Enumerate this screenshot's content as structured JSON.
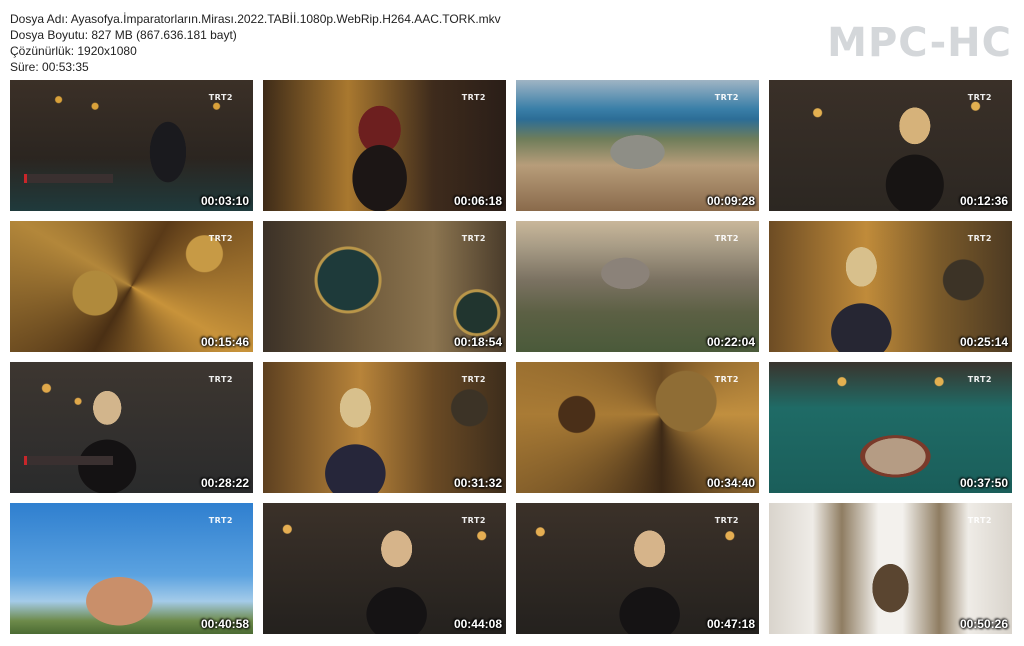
{
  "file_info": {
    "name_line": "Dosya Adı: Ayasofya.İmparatorların.Mirası.2022.TABİİ.1080p.WebRip.H264.AAC.TORK.mkv",
    "size_line": "Dosya Boyutu: 827 MB (867.636.181 bayt)",
    "resolution_line": "Çözünürlük: 1920x1080",
    "duration_line": "Süre: 00:53:35"
  },
  "logo": {
    "text": "MPC-HC",
    "color": "#d4d7da"
  },
  "thumbnails": [
    {
      "timestamp": "00:03:10",
      "channel_logo": "TRT2",
      "lower_third": true
    },
    {
      "timestamp": "00:06:18",
      "channel_logo": "TRT2"
    },
    {
      "timestamp": "00:09:28",
      "channel_logo": "TRT2"
    },
    {
      "timestamp": "00:12:36",
      "channel_logo": "TRT2"
    },
    {
      "timestamp": "00:15:46",
      "channel_logo": "TRT2"
    },
    {
      "timestamp": "00:18:54",
      "channel_logo": "TRT2"
    },
    {
      "timestamp": "00:22:04",
      "channel_logo": "TRT2"
    },
    {
      "timestamp": "00:25:14",
      "channel_logo": "TRT2"
    },
    {
      "timestamp": "00:28:22",
      "channel_logo": "TRT2",
      "lower_third": true
    },
    {
      "timestamp": "00:31:32",
      "channel_logo": "TRT2"
    },
    {
      "timestamp": "00:34:40",
      "channel_logo": "TRT2"
    },
    {
      "timestamp": "00:37:50",
      "channel_logo": "TRT2"
    },
    {
      "timestamp": "00:40:58",
      "channel_logo": "TRT2"
    },
    {
      "timestamp": "00:44:08",
      "channel_logo": "TRT2"
    },
    {
      "timestamp": "00:47:18",
      "channel_logo": "TRT2"
    },
    {
      "timestamp": "00:50:26",
      "channel_logo": "TRT2"
    }
  ]
}
